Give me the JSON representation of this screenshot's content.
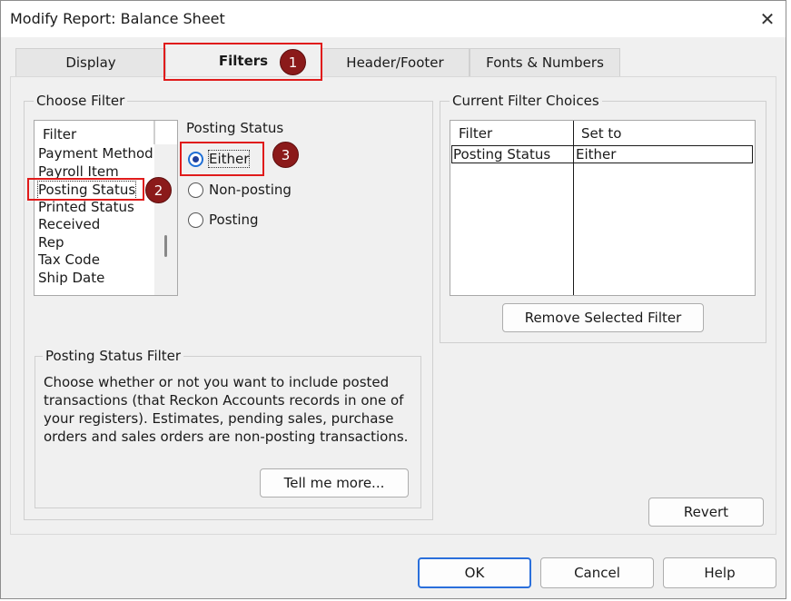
{
  "window": {
    "title": "Modify Report: Balance Sheet",
    "close_glyph": "✕"
  },
  "tabs": [
    {
      "label": "Display"
    },
    {
      "label": "Filters"
    },
    {
      "label": "Header/Footer"
    },
    {
      "label": "Fonts & Numbers"
    }
  ],
  "choose_filter": {
    "group_label": "Choose Filter",
    "list_header": "Filter",
    "items": [
      "Payment Method",
      "Payroll Item",
      "Posting Status",
      "Printed Status",
      "Received",
      "Rep",
      "Tax Code",
      "Ship Date"
    ],
    "selected_item": "Posting Status"
  },
  "posting_status": {
    "label": "Posting Status",
    "options": [
      "Either",
      "Non-posting",
      "Posting"
    ],
    "selected": "Either"
  },
  "filter_help": {
    "group_label": "Posting Status Filter",
    "text": "Choose whether or not you want to include posted transactions (that Reckon Accounts records in one of your registers). Estimates, pending sales, purchase orders and sales orders are non-posting transactions.",
    "tell_me_more": "Tell me more..."
  },
  "current_filter_choices": {
    "group_label": "Current Filter Choices",
    "columns": [
      "Filter",
      "Set to"
    ],
    "rows": [
      {
        "filter": "Posting Status",
        "set_to": "Either"
      }
    ],
    "remove_button": "Remove Selected Filter"
  },
  "buttons": {
    "revert": "Revert",
    "ok": "OK",
    "cancel": "Cancel",
    "help": "Help"
  },
  "annotations": {
    "marker_1": "1",
    "marker_2": "2",
    "marker_3": "3"
  },
  "colors": {
    "annotation_red": "#e01b1b",
    "marker_fill": "#8b1a1a",
    "radio_blue": "#1f6fd6"
  }
}
